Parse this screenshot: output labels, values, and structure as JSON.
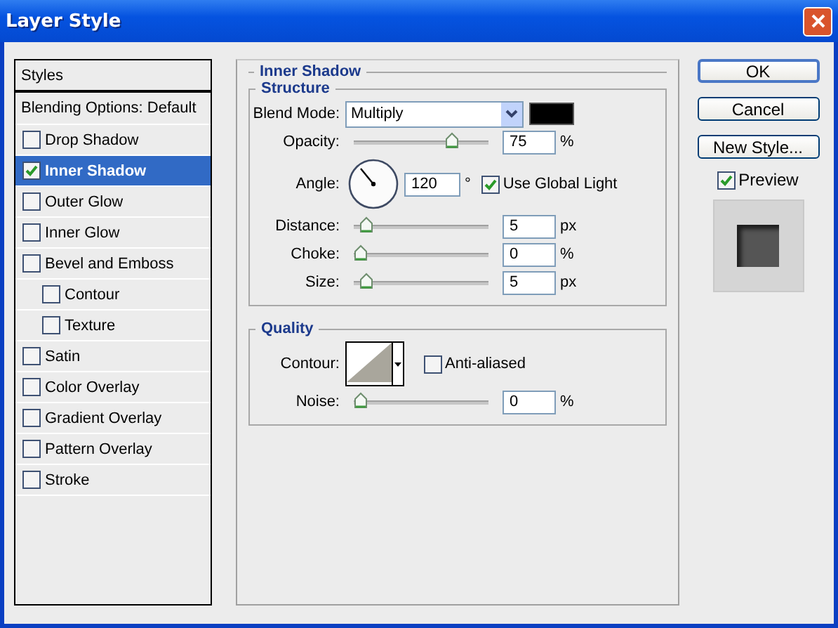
{
  "window": {
    "title": "Layer Style"
  },
  "styles_list": {
    "items": [
      {
        "kind": "header",
        "label": "Styles",
        "selected": false
      },
      {
        "kind": "header",
        "label": "Blending Options: Default",
        "selected": false
      },
      {
        "kind": "check",
        "label": "Drop Shadow",
        "checked": false,
        "selected": false
      },
      {
        "kind": "check",
        "label": "Inner Shadow",
        "checked": true,
        "selected": true
      },
      {
        "kind": "check",
        "label": "Outer Glow",
        "checked": false,
        "selected": false
      },
      {
        "kind": "check",
        "label": "Inner Glow",
        "checked": false,
        "selected": false
      },
      {
        "kind": "check",
        "label": "Bevel and Emboss",
        "checked": false,
        "selected": false,
        "children": [
          {
            "kind": "check",
            "label": "Contour",
            "checked": false,
            "selected": false
          },
          {
            "kind": "check",
            "label": "Texture",
            "checked": false,
            "selected": false
          }
        ]
      },
      {
        "kind": "check",
        "label": "Satin",
        "checked": false,
        "selected": false
      },
      {
        "kind": "check",
        "label": "Color Overlay",
        "checked": false,
        "selected": false
      },
      {
        "kind": "check",
        "label": "Gradient Overlay",
        "checked": false,
        "selected": false
      },
      {
        "kind": "check",
        "label": "Pattern Overlay",
        "checked": false,
        "selected": false
      },
      {
        "kind": "check",
        "label": "Stroke",
        "checked": false,
        "selected": false
      }
    ]
  },
  "panel": {
    "title": "Inner Shadow",
    "structure": {
      "title": "Structure",
      "rows": [
        {
          "kind": "select",
          "label": "Blend Mode:",
          "value": "Multiply"
        },
        {
          "kind": "slider",
          "label": "Opacity:",
          "level": 0.75,
          "value": "75",
          "unit": "%"
        },
        {
          "kind": "angle",
          "label": "Angle:",
          "value": "120",
          "unit": "°",
          "checkbox": {
            "label": "Use Global Light",
            "checked": true
          }
        },
        {
          "kind": "slider",
          "label": "Distance:",
          "level": 0.05,
          "value": "5",
          "unit": "px"
        },
        {
          "kind": "slider",
          "label": "Choke:",
          "level": 0,
          "value": "0",
          "unit": "%"
        },
        {
          "kind": "slider",
          "label": "Size:",
          "level": 0.05,
          "value": "5",
          "unit": "px"
        }
      ]
    },
    "quality": {
      "title": "Quality",
      "rows": [
        {
          "kind": "contour",
          "label": "Contour:",
          "checkbox": {
            "label": "Anti-aliased",
            "checked": false
          }
        },
        {
          "kind": "slider",
          "label": "Noise:",
          "level": 0,
          "value": "0",
          "unit": "%"
        }
      ]
    }
  },
  "buttons": [
    {
      "label": "OK",
      "default": true
    },
    {
      "label": "Cancel",
      "default": false
    },
    {
      "label": "New Style...",
      "default": false
    }
  ],
  "preview": {
    "label": "Preview",
    "checked": true
  }
}
